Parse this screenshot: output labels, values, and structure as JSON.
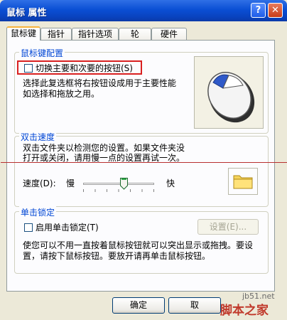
{
  "window": {
    "title": "鼠标 属性",
    "help_glyph": "?",
    "close_glyph": "✕"
  },
  "tabs": [
    {
      "label": "鼠标键"
    },
    {
      "label": "指针"
    },
    {
      "label": "指针选项"
    },
    {
      "label": "轮"
    },
    {
      "label": "硬件"
    }
  ],
  "button_config": {
    "group_label": "鼠标键配置",
    "switch_label": "切换主要和次要的按钮(S)",
    "description_line1": "选择此复选框将右按钮设成用于主要性能",
    "description_line2": "如选择和拖放之用。"
  },
  "double_click": {
    "group_label": "双击速度",
    "description_line1": "双击文件夹以检测您的设置。如果文件夹没",
    "description_line2": "打开或关闭，请用慢一点的设置再试一次。",
    "speed_label": "速度(D):",
    "slow_label": "慢",
    "fast_label": "快",
    "speed_level": 0.58
  },
  "click_lock": {
    "group_label": "单击锁定",
    "enable_label": "启用单击锁定(T)",
    "settings_button": "设置(E)...",
    "description_line1": "使您可以不用一直按着鼠标按钮就可以突出显示或拖拽。要设",
    "description_line2": "置，请按下鼠标按钮。要放开请再单击鼠标按钮。"
  },
  "footer": {
    "ok_button": "确定",
    "cancel_button": "取"
  },
  "watermark": {
    "site": "jb51.net",
    "name": "脚本之家"
  },
  "colors": {
    "title_bar": "#0a4fd4",
    "group_label": "#0046d5",
    "annotation": "#d92020"
  }
}
